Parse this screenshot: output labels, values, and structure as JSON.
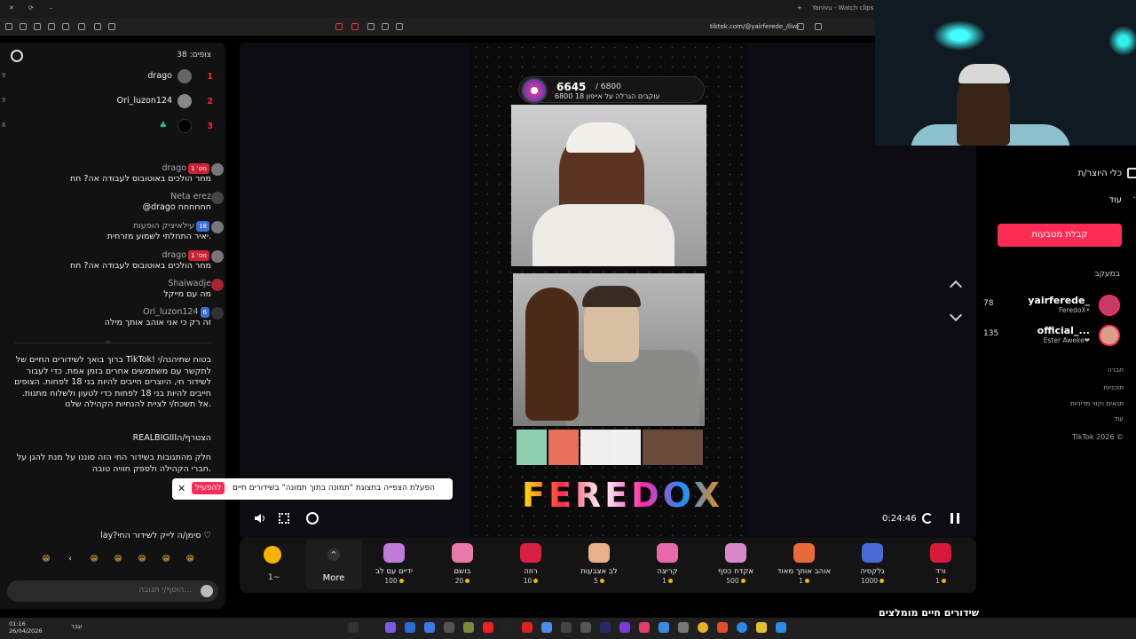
{
  "browser": {
    "tab_title": "Yanivu - Watch clips on Ki",
    "url": "tiktok.com/@yairferede_/live"
  },
  "chat": {
    "viewers_label": "צופים: 38",
    "top_viewers": [
      {
        "rank": "1",
        "name": "drago",
        "score": "9"
      },
      {
        "rank": "2",
        "name": "Ori_luzon124",
        "score": "9"
      },
      {
        "rank": "3",
        "name": "",
        "score": "8"
      }
    ],
    "messages": [
      {
        "user": "drago",
        "badge": "מס' 1",
        "text": "מחר הולכים באוטובוס לעבודה אה? חח"
      },
      {
        "user": "Neta erez",
        "badge": "",
        "text": "@drago חחחחחח"
      },
      {
        "user": "עילאיציק הופעות",
        "badge": "18",
        "text": "יאיר התחלתי לשמוע מזרחית."
      },
      {
        "user": "drago",
        "badge": "מס' 1",
        "text": "מחר הולכים באוטובוס לעבודה אה? חח"
      },
      {
        "user": "Shaiwadje",
        "badge": "",
        "text": "מה עם מייקל"
      },
      {
        "user": "Ori_luzon124",
        "badge": "6",
        "text": "זה רק כי אני אוהב אותך מילה"
      }
    ],
    "sep_label": "ש",
    "system_welcome": "ברוך בואך לשידורים החיים של TikTok! בטוח שתיהנה/י לתקשר עם משתמשים אחרים בזמן אמת. כדי לעבור לשידור חי, היוצרים חייבים להיות בני 18 לפחות. הצופים חייבים להיות בני 18 לפחות כדי לטעון ולשלוח מתנות. אל תשכח/י לציית להנחיות הקהילה שלנו.",
    "system_joined": "REALBIGIIIהצטרף/ה",
    "system_filter": "חלק מהתגובות בשידור החי הזה סוננו על מנת להגן על חברי הקהילה ולספק חוויה טובה.",
    "like_text": "lay?סימן/ה לייק לשידור החי",
    "emojis": [
      "😁",
      "😁",
      "😁",
      "😁",
      "😁",
      "😁",
      "😁"
    ],
    "input_placeholder": "הוסף/י תגובה..."
  },
  "stage": {
    "goal_value": "6645",
    "goal_max": "/ 6800",
    "goal_desc": "6800 עוקבים הגרלה על אייפון 18",
    "logo_text": "FEREDOX",
    "time": "0:24:46",
    "tooltip_text": "הפעלת הצפייה בתצוגת \"תמונה בתוך תמונה\" בשידורים חיים",
    "tooltip_action": "להפעיל",
    "tooltip_close": "✕"
  },
  "gift_bar": {
    "coin_label": "1~",
    "more_label": "More",
    "gifts": [
      {
        "name": "ידיים עם לב",
        "price": "100",
        "color": "#c07ad8"
      },
      {
        "name": "בושם",
        "price": "20",
        "color": "#e87aa8"
      },
      {
        "name": "רוזה",
        "price": "10",
        "color": "#d82040"
      },
      {
        "name": "לב אצבעות",
        "price": "5",
        "color": "#e8b08a"
      },
      {
        "name": "קריצה",
        "price": "1",
        "color": "#e86aa8"
      },
      {
        "name": "אקדח כסף",
        "price": "500",
        "color": "#d88ac8"
      },
      {
        "name": "אוהב אותך מאוד",
        "price": "1",
        "color": "#e86a3a"
      },
      {
        "name": "גלקסיה",
        "price": "1000",
        "color": "#4a6ad8"
      },
      {
        "name": "ורד",
        "price": "1",
        "color": "#d81a3a"
      }
    ]
  },
  "sidebar": {
    "nav_creator": "כלי היוצר/ת",
    "nav_more": "עוד",
    "coins_button": "קבלת מטבעות",
    "following_label": "במעקב",
    "following": [
      {
        "name": "yairferede_",
        "sub": "FeredoX•",
        "count": "78"
      },
      {
        "name": "official_...",
        "sub": "Ester Aweke❤",
        "count": "135"
      }
    ],
    "links": [
      "חברה",
      "תוכניות",
      "תנאים וקווי מדיניות",
      "עוד"
    ],
    "copyright": "TikTok 2026 ©",
    "bottom_heading": "שידורים חיים מומלצים"
  },
  "taskbar": {
    "time": "01:16",
    "date": "26/04/2026",
    "lang": "עבר"
  }
}
